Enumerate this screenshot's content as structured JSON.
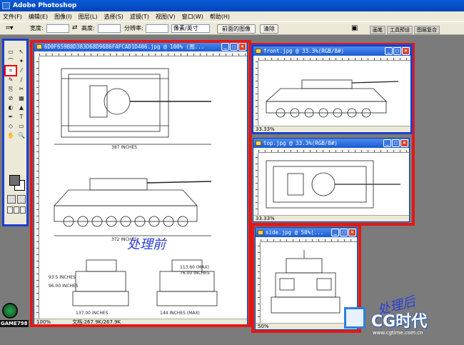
{
  "app": {
    "title": "Adobe Photoshop"
  },
  "menu": [
    "文件(F)",
    "编辑(E)",
    "图像(I)",
    "图层(L)",
    "选择(S)",
    "滤镜(T)",
    "视图(V)",
    "窗口(W)",
    "帮助(H)"
  ],
  "options": {
    "width_label": "宽度:",
    "height_label": "高度:",
    "resolution_label": "分辨率:",
    "unit_value": "像素/英寸",
    "front_image_button": "前面的图像",
    "clear_button": "清除",
    "tabs": [
      "画笔",
      "工具预设",
      "图层复合"
    ]
  },
  "tools": [
    "▭",
    "↖",
    "⌒",
    "✦",
    "⌗",
    "⁄",
    "✎",
    "∕",
    "⎘",
    "✂",
    "⊘",
    "▦",
    "◐",
    "▲",
    "✒",
    "T",
    "◇",
    "▭",
    "✋",
    "🔍"
  ],
  "documents": [
    {
      "name": "main-doc",
      "title": "6D0F659B8D383D68D9686FAFCAD1D406.jpg @ 100% (图...",
      "zoom": "100%",
      "status": "文档:267.9K/267.9K"
    },
    {
      "name": "front-doc",
      "title": "front.jpg @ 33.3%(RGB/8#)",
      "zoom": "33.33%"
    },
    {
      "name": "top-doc",
      "title": "top.jpg @ 33.3%(RGB/8#)",
      "zoom": "33.33%"
    },
    {
      "name": "side-doc",
      "title": "side.jpg @ 50%(...",
      "zoom": "50%"
    }
  ],
  "drawing": {
    "dim_top": "387 INCHES",
    "dim_side": "372 INCHES",
    "dim_front_left": "137.00 INCHES",
    "dim_front_right": "144 INCHES (MAX)",
    "dim_small_1": "93.5 INCHES",
    "dim_small_2": "96.00 INCHES",
    "dim_small_3": "113.60 (MAX)",
    "dim_small_4": "76.00 INCHES"
  },
  "annotations": {
    "before": "处理前",
    "after": "处理后"
  },
  "logos": {
    "left": "GAME798",
    "right_brand": "CG时代",
    "right_url": "www.cgtime.com.cn"
  },
  "colors": {
    "highlight_red": "#e21818",
    "highlight_blue": "#2040e0",
    "titlebar": "#0a5bd8"
  }
}
